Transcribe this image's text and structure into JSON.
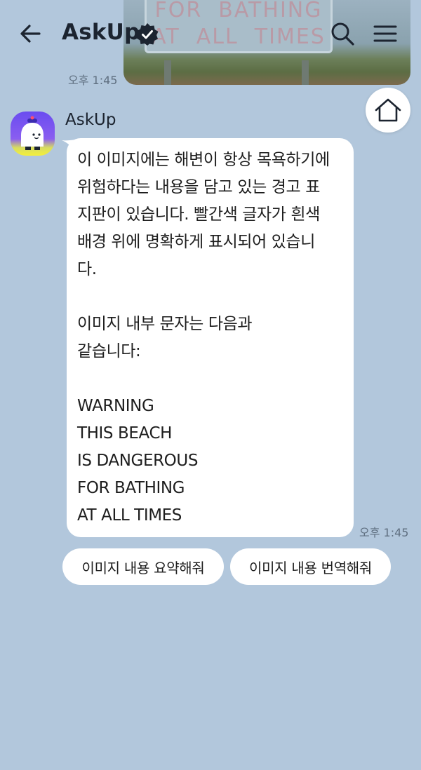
{
  "header": {
    "title": "AskUp",
    "back_icon": "back-arrow-icon",
    "verified_icon": "verified-badge-icon",
    "search_icon": "search-icon",
    "menu_icon": "menu-icon"
  },
  "home_button": {
    "icon": "home-icon"
  },
  "previous_message": {
    "sign_line_1": "FOR  BATHING",
    "sign_line_2": "AT  ALL  TIMES",
    "time": "오후 1:45"
  },
  "message": {
    "sender": "AskUp",
    "text": "이 이미지에는 해변이 항상 목욕하기에\n위험하다는 내용을 담고 있는 경고 표\n지판이 있습니다. 빨간색 글자가 흰색\n배경 위에 명확하게 표시되어 있습니\n다.\n\n이미지 내부 문자는 다음과\n같습니다:\n\nWARNING\nTHIS BEACH\nIS DANGEROUS\nFOR BATHING\nAT ALL TIMES",
    "time": "오후 1:45"
  },
  "quick_replies": [
    {
      "label": "이미지 내용 요약해줘"
    },
    {
      "label": "이미지 내용 번역해줘"
    }
  ],
  "colors": {
    "background": "#b2c7dc",
    "bubble": "#ffffff",
    "timestamp": "#5f6f80",
    "verified_badge": "#1c2430"
  }
}
